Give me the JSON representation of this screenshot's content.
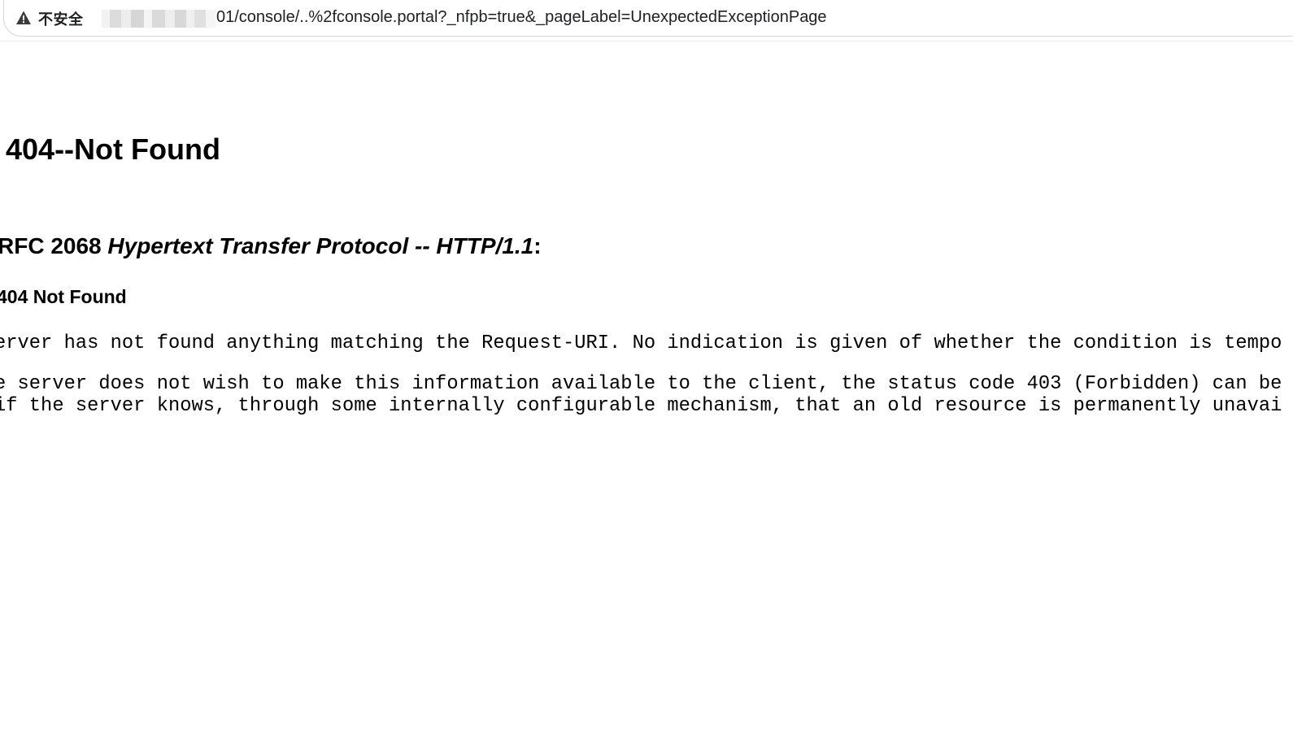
{
  "browser": {
    "security_label": "不安全",
    "url_visible": "01/console/..%2fconsole.portal?_nfpb=true&_pageLabel=UnexpectedExceptionPage",
    "icons": {
      "warning": "warning-triangle-icon"
    }
  },
  "content": {
    "title": "404--Not Found",
    "rfc_prefix": "RFC 2068 ",
    "rfc_title": "Hypertext Transfer Protocol -- HTTP/1.1",
    "rfc_suffix": ":",
    "code_heading": "404 Not Found",
    "paragraph1": "erver has not found anything matching the Request-URI. No indication is given of whether the condition is tempo",
    "paragraph2_line1": "e server does not wish to make this information available to the client, the status code 403 (Forbidden) can be",
    "paragraph2_line2": "if the server knows, through some internally configurable mechanism, that an old resource is permanently unavai"
  }
}
